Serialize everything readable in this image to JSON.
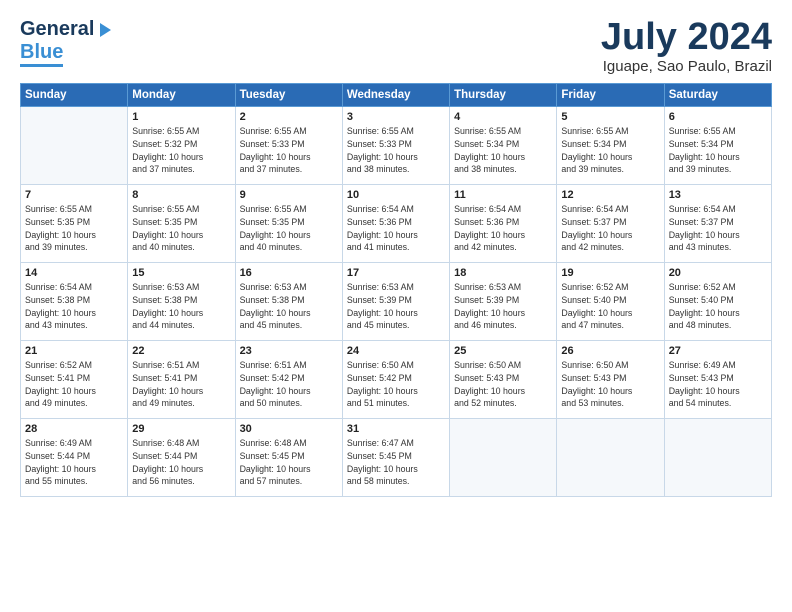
{
  "header": {
    "logo_general": "General",
    "logo_blue": "Blue",
    "title": "July 2024",
    "location": "Iguape, Sao Paulo, Brazil"
  },
  "days_of_week": [
    "Sunday",
    "Monday",
    "Tuesday",
    "Wednesday",
    "Thursday",
    "Friday",
    "Saturday"
  ],
  "weeks": [
    [
      {
        "day": "",
        "sunrise": "",
        "sunset": "",
        "daylight": ""
      },
      {
        "day": "1",
        "sunrise": "Sunrise: 6:55 AM",
        "sunset": "Sunset: 5:32 PM",
        "daylight": "Daylight: 10 hours and 37 minutes."
      },
      {
        "day": "2",
        "sunrise": "Sunrise: 6:55 AM",
        "sunset": "Sunset: 5:33 PM",
        "daylight": "Daylight: 10 hours and 37 minutes."
      },
      {
        "day": "3",
        "sunrise": "Sunrise: 6:55 AM",
        "sunset": "Sunset: 5:33 PM",
        "daylight": "Daylight: 10 hours and 38 minutes."
      },
      {
        "day": "4",
        "sunrise": "Sunrise: 6:55 AM",
        "sunset": "Sunset: 5:34 PM",
        "daylight": "Daylight: 10 hours and 38 minutes."
      },
      {
        "day": "5",
        "sunrise": "Sunrise: 6:55 AM",
        "sunset": "Sunset: 5:34 PM",
        "daylight": "Daylight: 10 hours and 39 minutes."
      },
      {
        "day": "6",
        "sunrise": "Sunrise: 6:55 AM",
        "sunset": "Sunset: 5:34 PM",
        "daylight": "Daylight: 10 hours and 39 minutes."
      }
    ],
    [
      {
        "day": "7",
        "sunrise": "Sunrise: 6:55 AM",
        "sunset": "Sunset: 5:35 PM",
        "daylight": "Daylight: 10 hours and 39 minutes."
      },
      {
        "day": "8",
        "sunrise": "Sunrise: 6:55 AM",
        "sunset": "Sunset: 5:35 PM",
        "daylight": "Daylight: 10 hours and 40 minutes."
      },
      {
        "day": "9",
        "sunrise": "Sunrise: 6:55 AM",
        "sunset": "Sunset: 5:35 PM",
        "daylight": "Daylight: 10 hours and 40 minutes."
      },
      {
        "day": "10",
        "sunrise": "Sunrise: 6:54 AM",
        "sunset": "Sunset: 5:36 PM",
        "daylight": "Daylight: 10 hours and 41 minutes."
      },
      {
        "day": "11",
        "sunrise": "Sunrise: 6:54 AM",
        "sunset": "Sunset: 5:36 PM",
        "daylight": "Daylight: 10 hours and 42 minutes."
      },
      {
        "day": "12",
        "sunrise": "Sunrise: 6:54 AM",
        "sunset": "Sunset: 5:37 PM",
        "daylight": "Daylight: 10 hours and 42 minutes."
      },
      {
        "day": "13",
        "sunrise": "Sunrise: 6:54 AM",
        "sunset": "Sunset: 5:37 PM",
        "daylight": "Daylight: 10 hours and 43 minutes."
      }
    ],
    [
      {
        "day": "14",
        "sunrise": "Sunrise: 6:54 AM",
        "sunset": "Sunset: 5:38 PM",
        "daylight": "Daylight: 10 hours and 43 minutes."
      },
      {
        "day": "15",
        "sunrise": "Sunrise: 6:53 AM",
        "sunset": "Sunset: 5:38 PM",
        "daylight": "Daylight: 10 hours and 44 minutes."
      },
      {
        "day": "16",
        "sunrise": "Sunrise: 6:53 AM",
        "sunset": "Sunset: 5:38 PM",
        "daylight": "Daylight: 10 hours and 45 minutes."
      },
      {
        "day": "17",
        "sunrise": "Sunrise: 6:53 AM",
        "sunset": "Sunset: 5:39 PM",
        "daylight": "Daylight: 10 hours and 45 minutes."
      },
      {
        "day": "18",
        "sunrise": "Sunrise: 6:53 AM",
        "sunset": "Sunset: 5:39 PM",
        "daylight": "Daylight: 10 hours and 46 minutes."
      },
      {
        "day": "19",
        "sunrise": "Sunrise: 6:52 AM",
        "sunset": "Sunset: 5:40 PM",
        "daylight": "Daylight: 10 hours and 47 minutes."
      },
      {
        "day": "20",
        "sunrise": "Sunrise: 6:52 AM",
        "sunset": "Sunset: 5:40 PM",
        "daylight": "Daylight: 10 hours and 48 minutes."
      }
    ],
    [
      {
        "day": "21",
        "sunrise": "Sunrise: 6:52 AM",
        "sunset": "Sunset: 5:41 PM",
        "daylight": "Daylight: 10 hours and 49 minutes."
      },
      {
        "day": "22",
        "sunrise": "Sunrise: 6:51 AM",
        "sunset": "Sunset: 5:41 PM",
        "daylight": "Daylight: 10 hours and 49 minutes."
      },
      {
        "day": "23",
        "sunrise": "Sunrise: 6:51 AM",
        "sunset": "Sunset: 5:42 PM",
        "daylight": "Daylight: 10 hours and 50 minutes."
      },
      {
        "day": "24",
        "sunrise": "Sunrise: 6:50 AM",
        "sunset": "Sunset: 5:42 PM",
        "daylight": "Daylight: 10 hours and 51 minutes."
      },
      {
        "day": "25",
        "sunrise": "Sunrise: 6:50 AM",
        "sunset": "Sunset: 5:43 PM",
        "daylight": "Daylight: 10 hours and 52 minutes."
      },
      {
        "day": "26",
        "sunrise": "Sunrise: 6:50 AM",
        "sunset": "Sunset: 5:43 PM",
        "daylight": "Daylight: 10 hours and 53 minutes."
      },
      {
        "day": "27",
        "sunrise": "Sunrise: 6:49 AM",
        "sunset": "Sunset: 5:43 PM",
        "daylight": "Daylight: 10 hours and 54 minutes."
      }
    ],
    [
      {
        "day": "28",
        "sunrise": "Sunrise: 6:49 AM",
        "sunset": "Sunset: 5:44 PM",
        "daylight": "Daylight: 10 hours and 55 minutes."
      },
      {
        "day": "29",
        "sunrise": "Sunrise: 6:48 AM",
        "sunset": "Sunset: 5:44 PM",
        "daylight": "Daylight: 10 hours and 56 minutes."
      },
      {
        "day": "30",
        "sunrise": "Sunrise: 6:48 AM",
        "sunset": "Sunset: 5:45 PM",
        "daylight": "Daylight: 10 hours and 57 minutes."
      },
      {
        "day": "31",
        "sunrise": "Sunrise: 6:47 AM",
        "sunset": "Sunset: 5:45 PM",
        "daylight": "Daylight: 10 hours and 58 minutes."
      },
      {
        "day": "",
        "sunrise": "",
        "sunset": "",
        "daylight": ""
      },
      {
        "day": "",
        "sunrise": "",
        "sunset": "",
        "daylight": ""
      },
      {
        "day": "",
        "sunrise": "",
        "sunset": "",
        "daylight": ""
      }
    ]
  ]
}
